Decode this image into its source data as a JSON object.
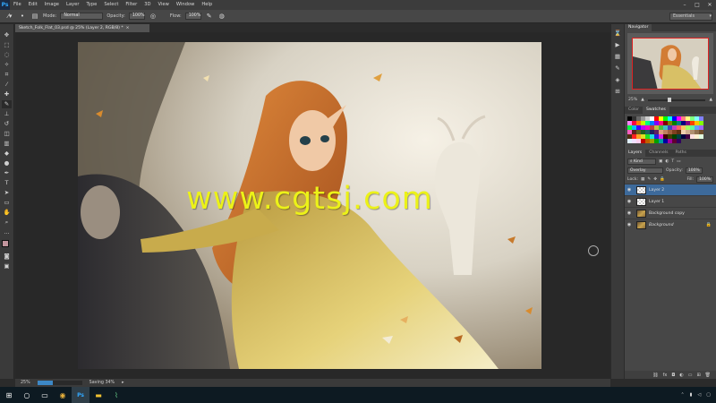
{
  "app": {
    "logo_text": "Ps"
  },
  "menu": [
    "File",
    "Edit",
    "Image",
    "Layer",
    "Type",
    "Select",
    "Filter",
    "3D",
    "View",
    "Window",
    "Help"
  ],
  "window_controls": [
    "–",
    "□",
    "✕"
  ],
  "options_bar": {
    "mode_label": "Mode:",
    "mode_value": "Normal",
    "opacity_label": "Opacity:",
    "opacity_value": "100%",
    "flow_label": "Flow:",
    "flow_value": "100%",
    "workspace": "Essentials"
  },
  "document": {
    "tab_title": "Sketch_Folk_Flat_03.psd @ 25% (Layer 2, RGB/8) *",
    "tab_close": "×",
    "watermark": "www.cgtsj.com"
  },
  "status": {
    "zoom": "25%",
    "message": "Saving 34%",
    "progress": 0.34
  },
  "panels": {
    "navigator_tab": "Navigator",
    "nav_zoom": "25%",
    "color_tab": "Color",
    "swatches_tab": "Swatches",
    "layers_tab": "Layers",
    "channels_tab": "Channels",
    "paths_tab": "Paths",
    "kind_label": "Kind",
    "blend_mode": "Overlay",
    "opacity_label": "Opacity:",
    "opacity_value": "100%",
    "lock_label": "Lock:",
    "fill_label": "Fill:",
    "fill_value": "100%",
    "layers": [
      {
        "name": "Layer 2",
        "thumb": "transparent",
        "selected": true
      },
      {
        "name": "Layer 1",
        "thumb": "transparent",
        "selected": false
      },
      {
        "name": "Background copy",
        "thumb": "image",
        "selected": false
      },
      {
        "name": "Background",
        "thumb": "image",
        "selected": false,
        "locked": true
      }
    ],
    "footer_icons": [
      "link-icon",
      "fx-icon",
      "mask-icon",
      "adjustment-icon",
      "folder-icon",
      "new-layer-icon",
      "trash-icon"
    ]
  },
  "swatches": [
    "#000000",
    "#333333",
    "#666666",
    "#999999",
    "#cccccc",
    "#ffffff",
    "#ff0000",
    "#ffff00",
    "#00ff00",
    "#00ffff",
    "#0000ff",
    "#ff00ff",
    "#ff8080",
    "#ffff80",
    "#80ff80",
    "#80ffff",
    "#8080ff",
    "#ff80ff",
    "#ff0040",
    "#ff8000",
    "#c0ff00",
    "#00ff80",
    "#0080ff",
    "#8000ff",
    "#ff0080",
    "#800000",
    "#808000",
    "#008000",
    "#008080",
    "#000080",
    "#800080",
    "#ff4000",
    "#ffbf00",
    "#80ff00",
    "#00ff40",
    "#00bfff",
    "#4000ff",
    "#bf00ff",
    "#ff00bf",
    "#c04040",
    "#c0c040",
    "#40c040",
    "#40c0c0",
    "#4040c0",
    "#c040c0",
    "#ff6060",
    "#ffc060",
    "#a0ff60",
    "#60ffa0",
    "#60a0ff",
    "#a060ff",
    "#ff60c0",
    "#602020",
    "#606020",
    "#206020",
    "#206060",
    "#202060",
    "#602060",
    "#e0a080",
    "#c08060",
    "#a06040",
    "#804020",
    "#603010",
    "#f0d0b0",
    "#d0b090",
    "#b09070",
    "#907050",
    "#705030",
    "#503010",
    "#ff2020",
    "#ffa020",
    "#e0e020",
    "#20e020",
    "#20e0e0",
    "#2020e0",
    "#e020e0",
    "#400000",
    "#404000",
    "#004000",
    "#004040",
    "#000040",
    "#400040",
    "#ffe0e0",
    "#fff0d0",
    "#e0ffe0",
    "#e0f0ff",
    "#f0e0ff",
    "#ffd0f0",
    "#c00000",
    "#c06000",
    "#a0a000",
    "#00a000",
    "#00a0a0",
    "#0000a0",
    "#a000a0",
    "#600030",
    "#300060"
  ],
  "taskbar": {
    "icons": [
      "windows-icon",
      "search-icon",
      "task-view-icon",
      "chrome-icon",
      "photoshop-icon",
      "file-explorer-icon",
      "chart-app-icon"
    ],
    "ps_label": "Ps"
  },
  "colors": {
    "foreground": "#c2959d",
    "background": "#ffffff",
    "selected_layer": "#3d6a9b",
    "watermark": "#ecf218"
  }
}
